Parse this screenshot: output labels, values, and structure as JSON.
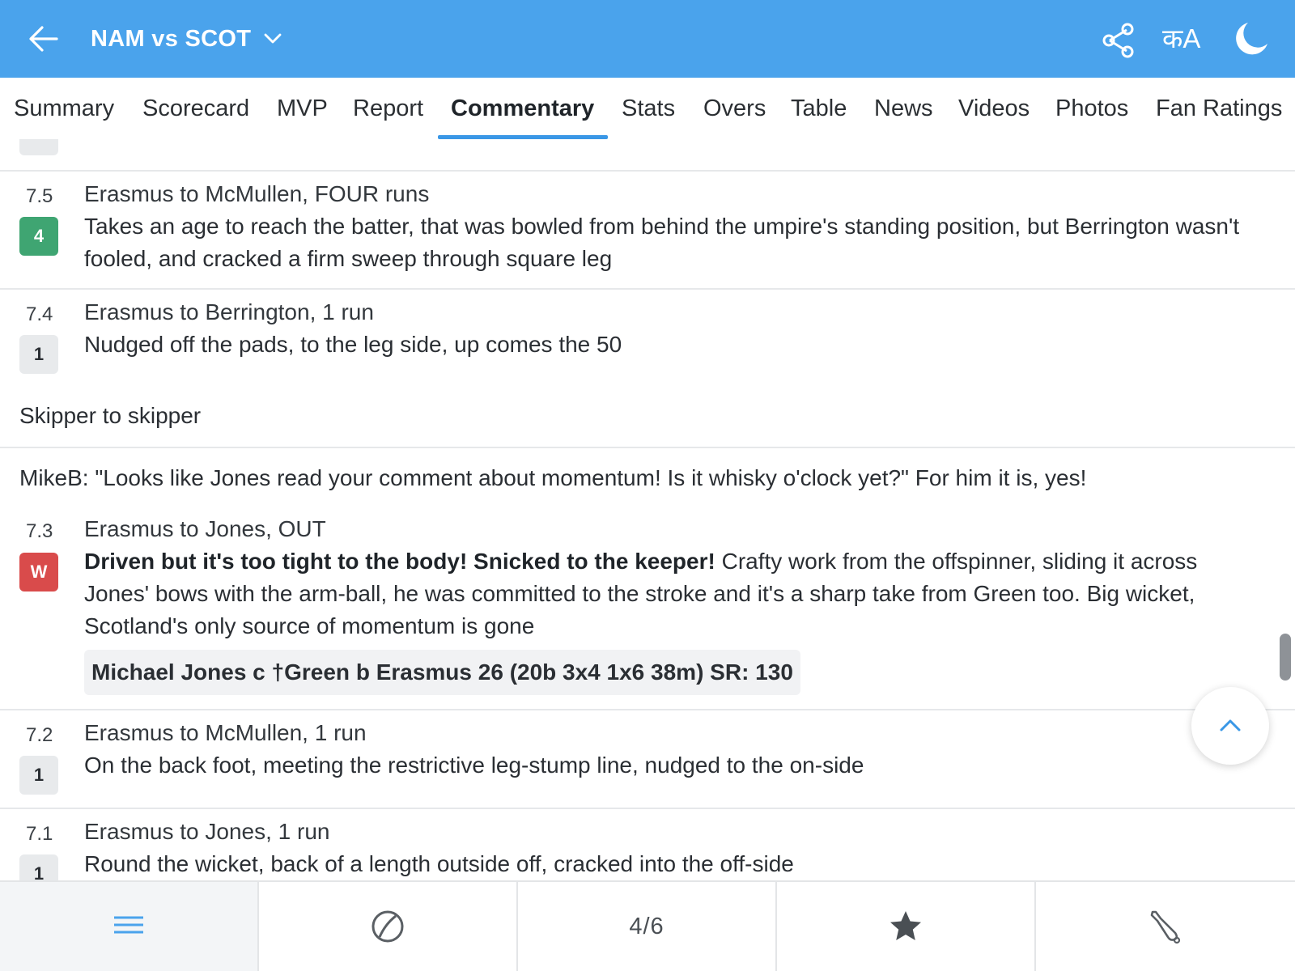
{
  "header": {
    "title": "NAM vs SCOT",
    "lang_label": "कA"
  },
  "tabs": [
    {
      "label": "Summary"
    },
    {
      "label": "Scorecard"
    },
    {
      "label": "MVP"
    },
    {
      "label": "Report"
    },
    {
      "label": "Commentary",
      "active": true
    },
    {
      "label": "Stats"
    },
    {
      "label": "Overs"
    },
    {
      "label": "Table"
    },
    {
      "label": "News"
    },
    {
      "label": "Videos"
    },
    {
      "label": "Photos"
    },
    {
      "label": "Fan Ratings"
    }
  ],
  "commentary": {
    "ball_7_5": {
      "over": "7.5",
      "badge": "4",
      "headline": "Erasmus to McMullen, FOUR runs",
      "text": "Takes an age to reach the batter, that was bowled from behind the umpire's standing position, but Berrington wasn't fooled, and cracked a firm sweep through square leg"
    },
    "ball_7_4": {
      "over": "7.4",
      "badge": "1",
      "headline": "Erasmus to Berrington, 1 run",
      "text": "Nudged off the pads, to the leg side, up comes the 50"
    },
    "note_1": "Skipper to skipper",
    "note_2": "MikeB: \"Looks like Jones read your comment about momentum! Is it whisky o'clock yet?\" For him it is, yes!",
    "ball_7_3": {
      "over": "7.3",
      "badge": "W",
      "headline": "Erasmus to Jones, OUT",
      "bold_text": "Driven but it's too tight to the body! Snicked to the keeper!",
      "text": " Crafty work from the offspinner, sliding it across Jones' bows with the arm-ball, he was committed to the stroke and it's a sharp take from Green too. Big wicket, Scotland's only source of momentum is gone",
      "dismissal": "Michael Jones c †Green b Erasmus 26 (20b 3x4 1x6 38m) SR: 130"
    },
    "ball_7_2": {
      "over": "7.2",
      "badge": "1",
      "headline": "Erasmus to McMullen, 1 run",
      "text": "On the back foot, meeting the restrictive leg-stump line, nudged to the on-side"
    },
    "ball_7_1": {
      "over": "7.1",
      "badge": "1",
      "headline": "Erasmus to Jones, 1 run",
      "text": "Round the wicket, back of a length outside off, cracked into the off-side"
    }
  },
  "bottom_bar": {
    "pager": "4/6"
  },
  "colors": {
    "header_bg": "#4aa3ec",
    "tab_indicator": "#3a97e6",
    "four_badge": "#3fa572",
    "wicket_badge": "#d94b4b",
    "run_badge": "#e8eaec"
  },
  "icons": {
    "back": "arrow-left-icon",
    "title_dropdown": "chevron-down-icon",
    "share": "share-icon",
    "language": "language-toggle-icon",
    "theme": "moon-icon",
    "back_to_top": "chevron-up-icon",
    "bottom_1": "menu-lines-icon",
    "bottom_2": "ball-icon",
    "bottom_4": "star-icon",
    "bottom_5": "cricket-bat-icon"
  }
}
